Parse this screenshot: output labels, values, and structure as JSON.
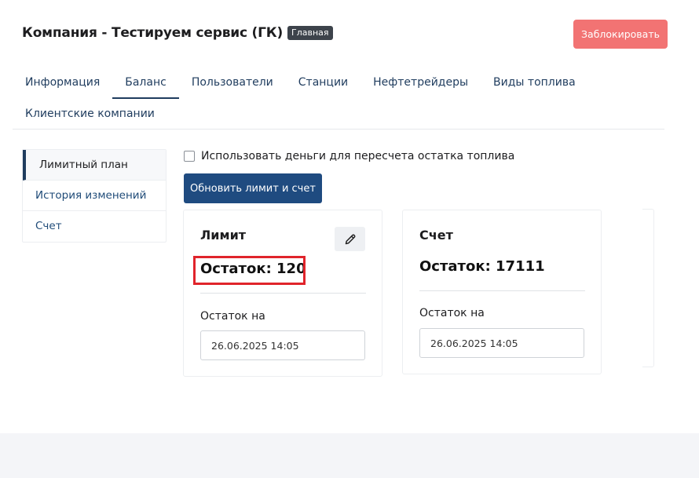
{
  "header": {
    "title": "Компания - Тестируем сервис (ГК)",
    "badge": "Главная",
    "block_button": "Заблокировать"
  },
  "tabs": [
    {
      "label": "Информация",
      "active": false
    },
    {
      "label": "Баланс",
      "active": true
    },
    {
      "label": "Пользователи",
      "active": false
    },
    {
      "label": "Станции",
      "active": false
    },
    {
      "label": "Нефтетрейдеры",
      "active": false
    },
    {
      "label": "Виды топлива",
      "active": false
    },
    {
      "label": "Клиентские компании",
      "active": false
    }
  ],
  "sidebar": {
    "items": [
      {
        "label": "Лимитный план",
        "active": true
      },
      {
        "label": "История изменений",
        "active": false
      },
      {
        "label": "Счет",
        "active": false
      }
    ]
  },
  "controls": {
    "checkbox_label": "Использовать деньги для пересчета остатка топлива",
    "checkbox_checked": false,
    "update_button": "Обновить лимит и счет"
  },
  "cards": {
    "limit": {
      "title": "Лимит",
      "remainder": "Остаток: 120",
      "date_label": "Остаток на",
      "date_value": "26.06.2025 14:05"
    },
    "account": {
      "title": "Счет",
      "remainder": "Остаток: 17111",
      "date_label": "Остаток на",
      "date_value": "26.06.2025 14:05"
    }
  },
  "colors": {
    "primary": "#1f4b80",
    "danger": "#f27373",
    "highlight": "#e0242b"
  }
}
